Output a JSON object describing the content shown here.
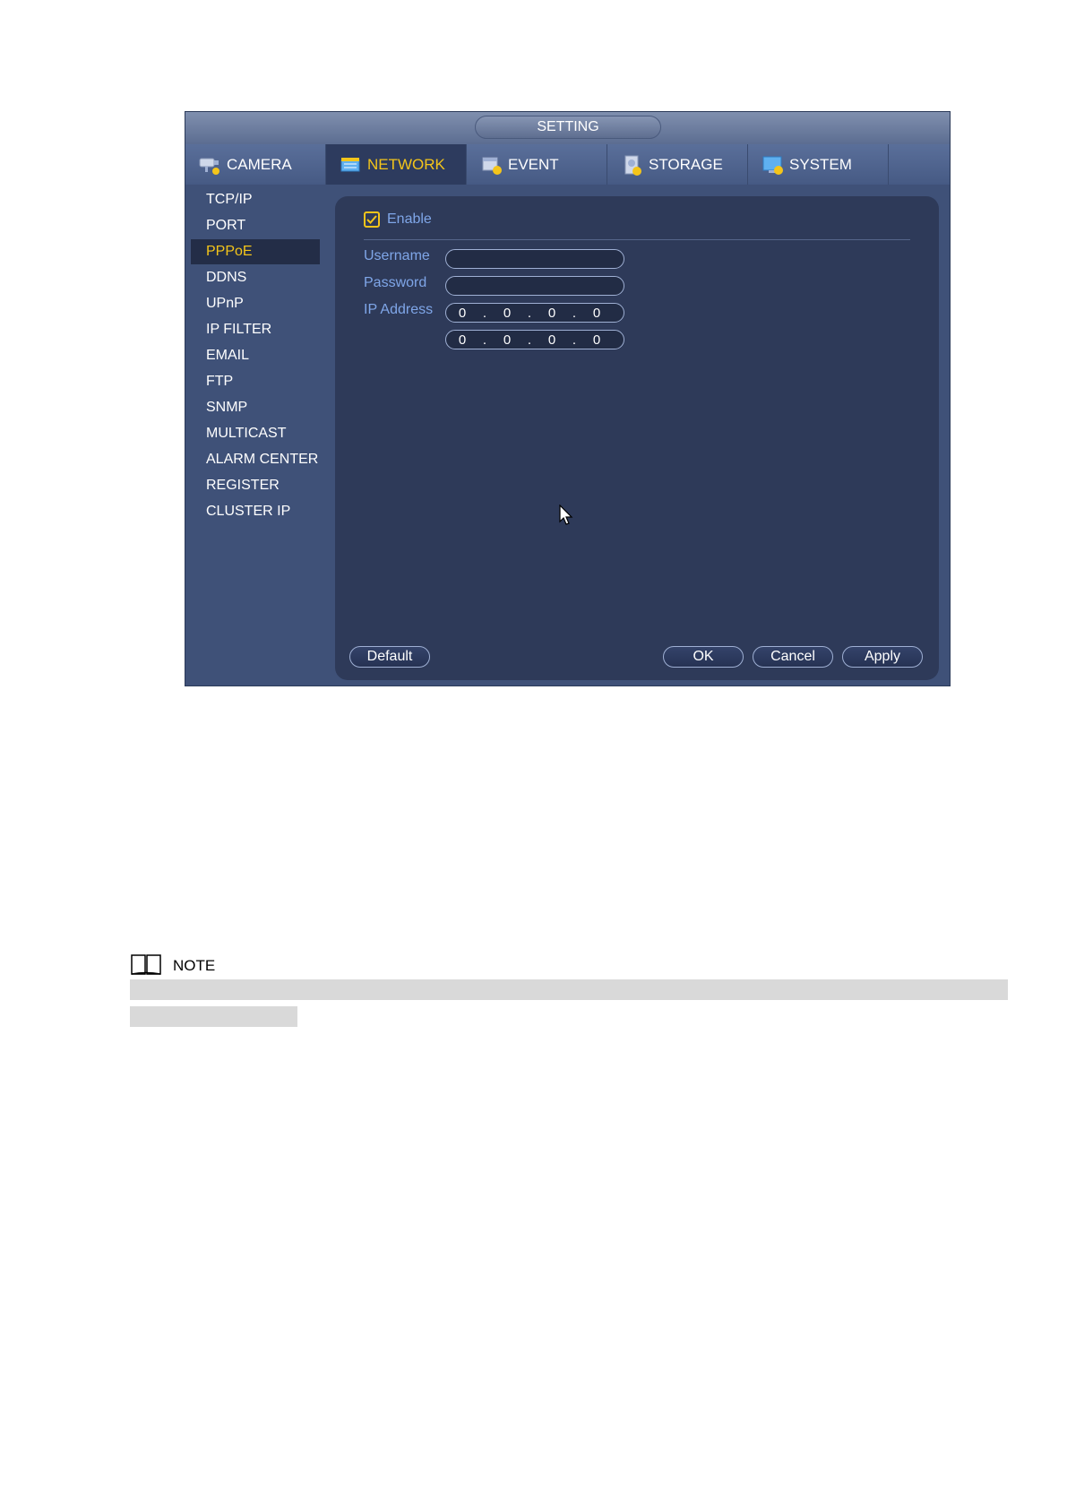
{
  "window": {
    "title": "SETTING"
  },
  "tabs": [
    {
      "label": "CAMERA",
      "icon": "camera-icon"
    },
    {
      "label": "NETWORK",
      "icon": "network-icon",
      "active": true
    },
    {
      "label": "EVENT",
      "icon": "event-icon"
    },
    {
      "label": "STORAGE",
      "icon": "storage-icon"
    },
    {
      "label": "SYSTEM",
      "icon": "system-icon"
    }
  ],
  "sidebar": {
    "items": [
      {
        "label": "TCP/IP"
      },
      {
        "label": "PORT"
      },
      {
        "label": "PPPoE",
        "active": true
      },
      {
        "label": "DDNS"
      },
      {
        "label": "UPnP"
      },
      {
        "label": "IP FILTER"
      },
      {
        "label": "EMAIL"
      },
      {
        "label": "FTP"
      },
      {
        "label": "SNMP"
      },
      {
        "label": "MULTICAST"
      },
      {
        "label": "ALARM CENTER"
      },
      {
        "label": "REGISTER"
      },
      {
        "label": "CLUSTER IP"
      }
    ]
  },
  "form": {
    "enable_label": "Enable",
    "enable_checked": true,
    "username_label": "Username",
    "username_value": "",
    "password_label": "Password",
    "password_value": "",
    "ip_label": "IP Address",
    "ip1": [
      "0",
      "0",
      "0",
      "0"
    ],
    "ip2": [
      "0",
      "0",
      "0",
      "0"
    ],
    "ip_separator": "."
  },
  "buttons": {
    "default": "Default",
    "ok": "OK",
    "cancel": "Cancel",
    "apply": "Apply"
  },
  "note": {
    "label": "NOTE"
  },
  "colors": {
    "accent": "#f4c51a",
    "label_blue": "#7fa6e8",
    "panel": "#2e3a59",
    "window": "#3f5178"
  }
}
